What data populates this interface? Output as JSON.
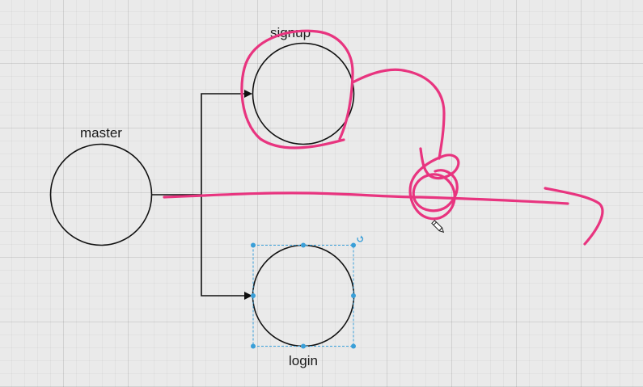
{
  "canvas": {
    "grid": true
  },
  "nodes": {
    "master": {
      "label": "master"
    },
    "signup": {
      "label": "signup"
    },
    "login": {
      "label": "login",
      "selected": true
    }
  },
  "colors": {
    "ink": "#e8347f",
    "selection": "#3a9fd8",
    "stroke": "#111111"
  },
  "icons": {
    "rotate": "rotate-handle-icon",
    "pencil": "pencil-cursor-icon"
  }
}
